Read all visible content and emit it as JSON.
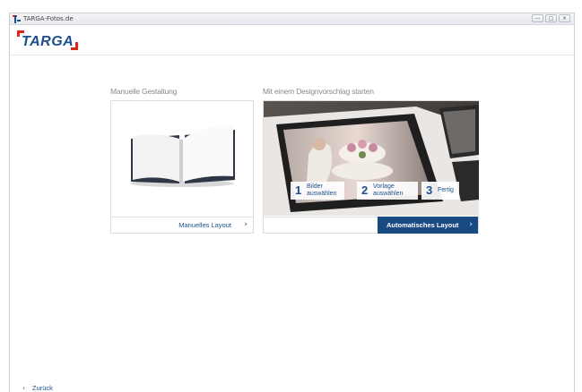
{
  "window": {
    "title": "TARGA-Fotos.de",
    "buttons": [
      "—",
      "□",
      "✕"
    ]
  },
  "header": {
    "logo_text": "TARGA"
  },
  "manual": {
    "section_label": "Manuelle Gestaltung",
    "button_label": "Manuelles Layout",
    "chevron": "›"
  },
  "design": {
    "section_label": "Mit einem Designvorschlag starten",
    "button_label": "Automatisches Layout",
    "chevron": "›",
    "steps": [
      {
        "num": "1",
        "text": "Bilder auswählen"
      },
      {
        "num": "2",
        "text": "Vorlage auswählen"
      },
      {
        "num": "3",
        "text": "Fertig"
      }
    ]
  },
  "footer": {
    "back_label": "Zurück",
    "back_chevron": "‹"
  },
  "colors": {
    "brand_blue": "#1d4f8c",
    "accent_red": "#e2231a",
    "button_dark_blue": "#1a4a82"
  }
}
